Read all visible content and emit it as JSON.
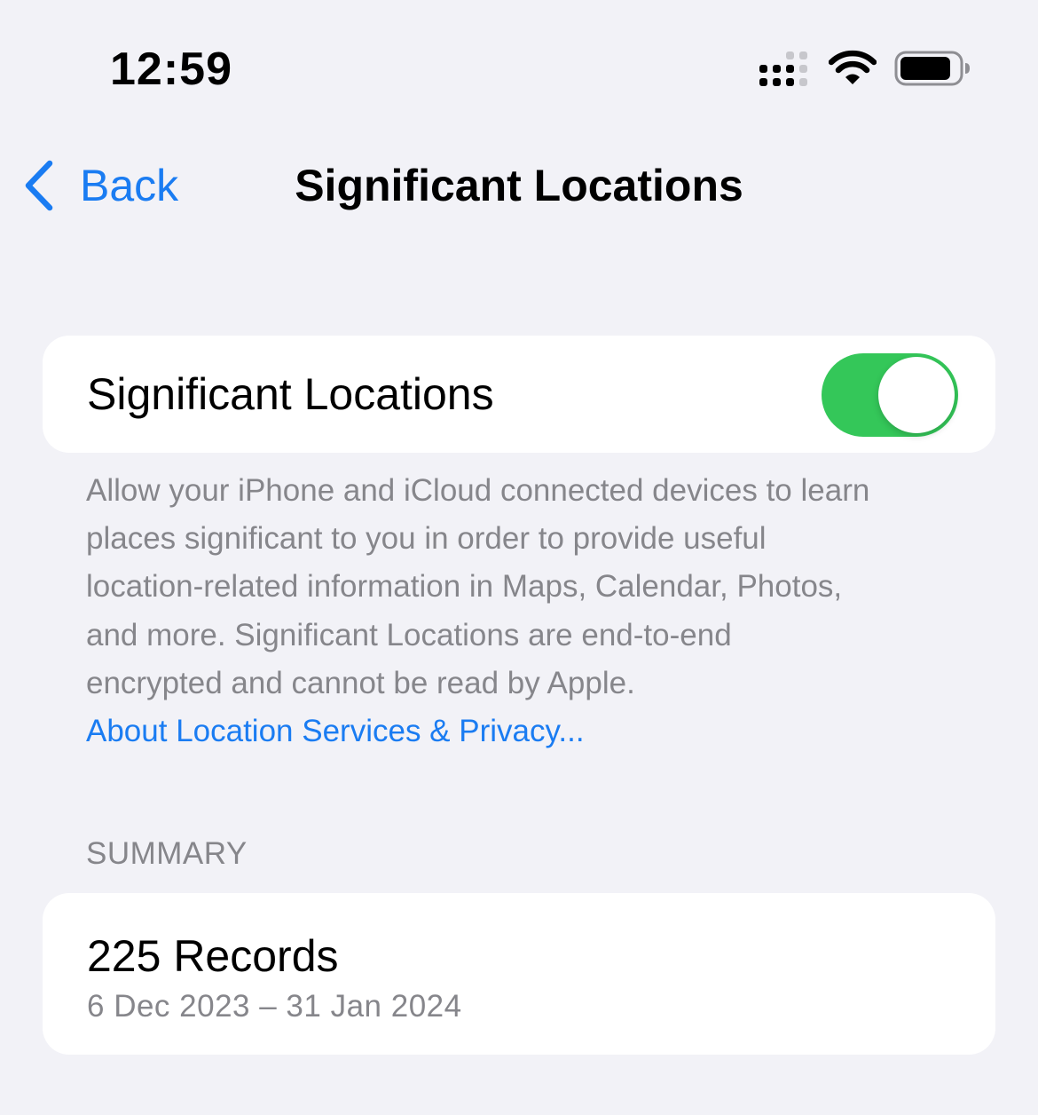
{
  "status_bar": {
    "time": "12:59",
    "icons": [
      "signal-icon",
      "wifi-icon",
      "battery-icon"
    ]
  },
  "nav": {
    "back_label": "Back",
    "title": "Significant Locations"
  },
  "toggle_row": {
    "label": "Significant Locations",
    "enabled": true
  },
  "footer": {
    "lines": [
      "Allow your iPhone and iCloud connected devices to learn",
      "places significant to you in order to provide useful",
      "location-related information in Maps, Calendar, Photos,",
      "and more. Significant Locations are end-to-end",
      "encrypted and cannot be read by Apple."
    ],
    "link": "About Location Services & Privacy..."
  },
  "summary": {
    "header": "SUMMARY",
    "records": "225 Records",
    "range": "6 Dec 2023 – 31 Jan 2024"
  },
  "colors": {
    "background": "#f2f2f7",
    "accent": "#1a7cf2",
    "toggle_on": "#34c759",
    "secondary_text": "#86868b"
  }
}
